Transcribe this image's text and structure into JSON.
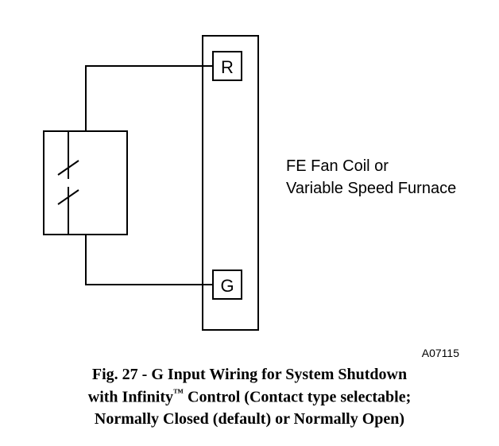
{
  "terminal_r": "R",
  "terminal_g": "G",
  "equipment_label_line1": "FE Fan Coil or",
  "equipment_label_line2": "Variable Speed Furnace",
  "reference_id": "A07115",
  "caption": {
    "fig_prefix": "Fig. 27 -",
    "title_line1_rest": " G Input Wiring for System Shutdown",
    "line2_pre": "with Infinity",
    "tm": "™",
    "line2_post": " Control (Contact type selectable;",
    "line3": "Normally Closed (default) or Normally Open)"
  }
}
